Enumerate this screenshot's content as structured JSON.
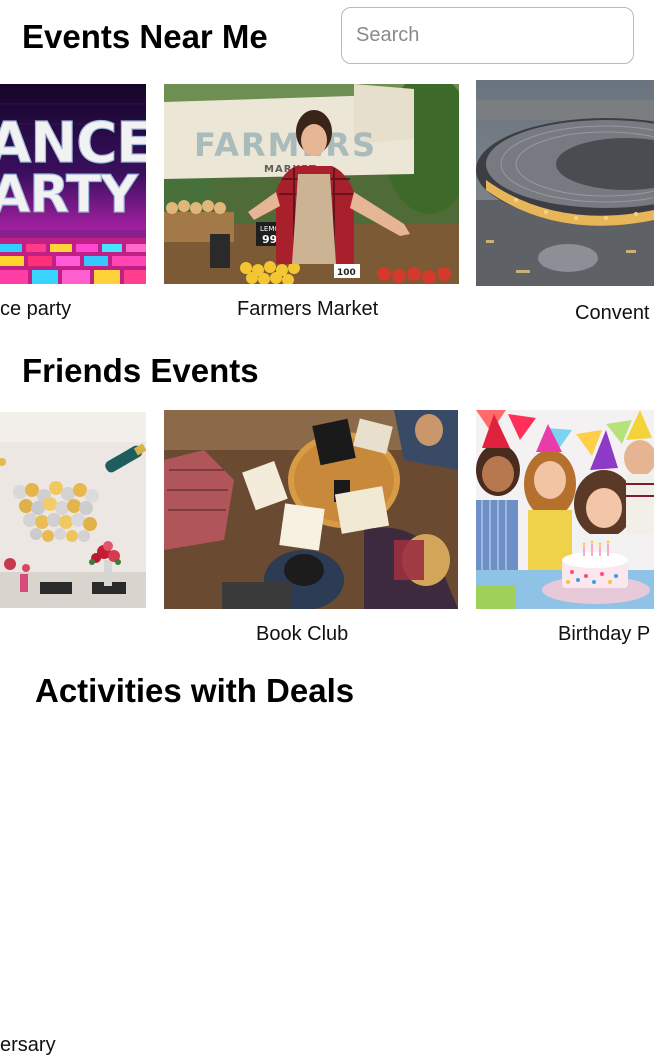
{
  "sections": {
    "events_near_me": {
      "title": "Events Near Me",
      "search_placeholder": "Search",
      "cards": [
        {
          "caption": "ce party",
          "image_text": [
            "ANCE",
            "ARTY"
          ]
        },
        {
          "caption": "Farmers Market",
          "image_text": [
            "FARMERS",
            "MARKET",
            "LEMON",
            "99¢",
            "100"
          ]
        },
        {
          "caption": "Convent"
        }
      ]
    },
    "friends_events": {
      "title": "Friends Events",
      "cards": [
        {
          "caption": "ersary"
        },
        {
          "caption": "Book Club"
        },
        {
          "caption": "Birthday P"
        }
      ]
    },
    "activities_with_deals": {
      "title": "Activities with Deals"
    }
  },
  "colors": {
    "text": "#000000",
    "search_border": "#b9b9b9",
    "placeholder": "#8a8a8a"
  }
}
